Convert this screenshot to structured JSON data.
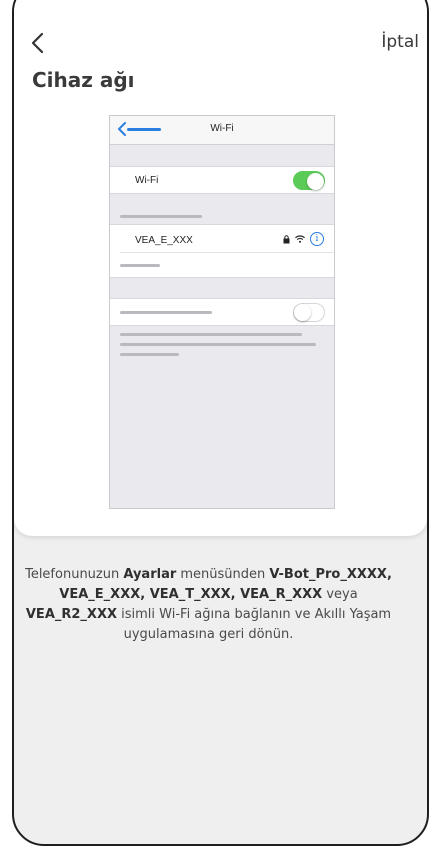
{
  "header": {
    "back_icon": "chevron-left-icon",
    "cancel_label": "İptal",
    "title": "Cihaz ağı"
  },
  "illustration": {
    "nav_title": "Wi-Fi",
    "wifi_row_label": "Wi-Fi",
    "wifi_toggle_on": true,
    "network_name": "VEA_E_XXX",
    "network_icons": [
      "lock-icon",
      "wifi-signal-icon",
      "info-icon"
    ],
    "info_glyph": "i",
    "second_toggle_on": false,
    "accent_color": "#2a7de1",
    "toggle_on_color": "#5bcb58"
  },
  "instruction": {
    "p1": "Telefonunuzun ",
    "b1": "Ayarlar",
    "p2": " menüsünden ",
    "b2": "V-Bot_Pro_XXXX, VEA_E_XXX, VEA_T_XXX, VEA_R_XXX",
    "p3": " veya ",
    "b3": "VEA_R2_XXX",
    "p4": " isimli Wi-Fi ağına bağlanın ve Akıllı Yaşam uygulamasına geri dönün."
  }
}
